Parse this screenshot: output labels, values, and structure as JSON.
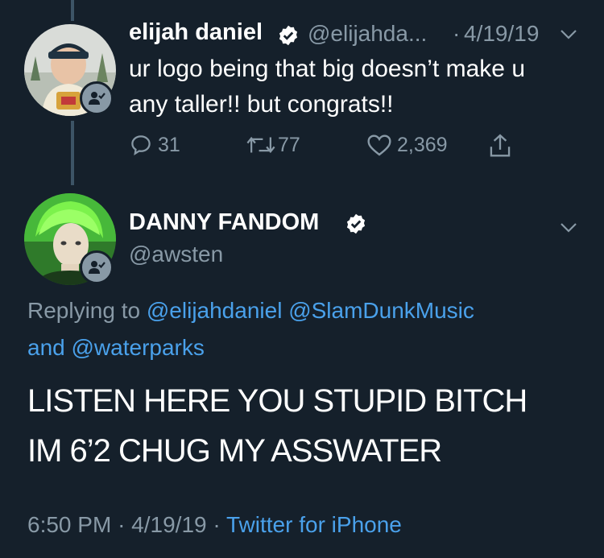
{
  "parent_tweet": {
    "display_name": "elijah daniel",
    "handle": "@elijahda...",
    "separator": "·",
    "date": "4/19/19",
    "text_line1": "ur logo being that big doesn’t make u",
    "text_line2": "any taller!! but congrats!!",
    "replies": "31",
    "retweets": "77",
    "likes": "2,369"
  },
  "main_tweet": {
    "display_name": "DANNY FANDOM",
    "handle": "@awsten",
    "replying_prefix": "Replying to",
    "mention1": "@elijahdaniel",
    "mention2": "@SlamDunkMusic",
    "and_word": "and",
    "mention3": "@waterparks",
    "text_line1": "LISTEN HERE YOU STUPID BITCH",
    "text_line2": "IM 6’2 CHUG MY ASSWATER",
    "time": "6:50 PM",
    "sep1": "·",
    "date": "4/19/19",
    "sep2": "·",
    "source": "Twitter for iPhone"
  },
  "colors": {
    "background": "#15202b",
    "secondary_text": "#8899a6",
    "link": "#4aa1eb",
    "thread_line": "#3d5466"
  },
  "icons": [
    "verified-badge-icon",
    "chevron-down-icon",
    "reply-icon",
    "retweet-icon",
    "like-icon",
    "share-icon",
    "follow-badge-icon"
  ]
}
